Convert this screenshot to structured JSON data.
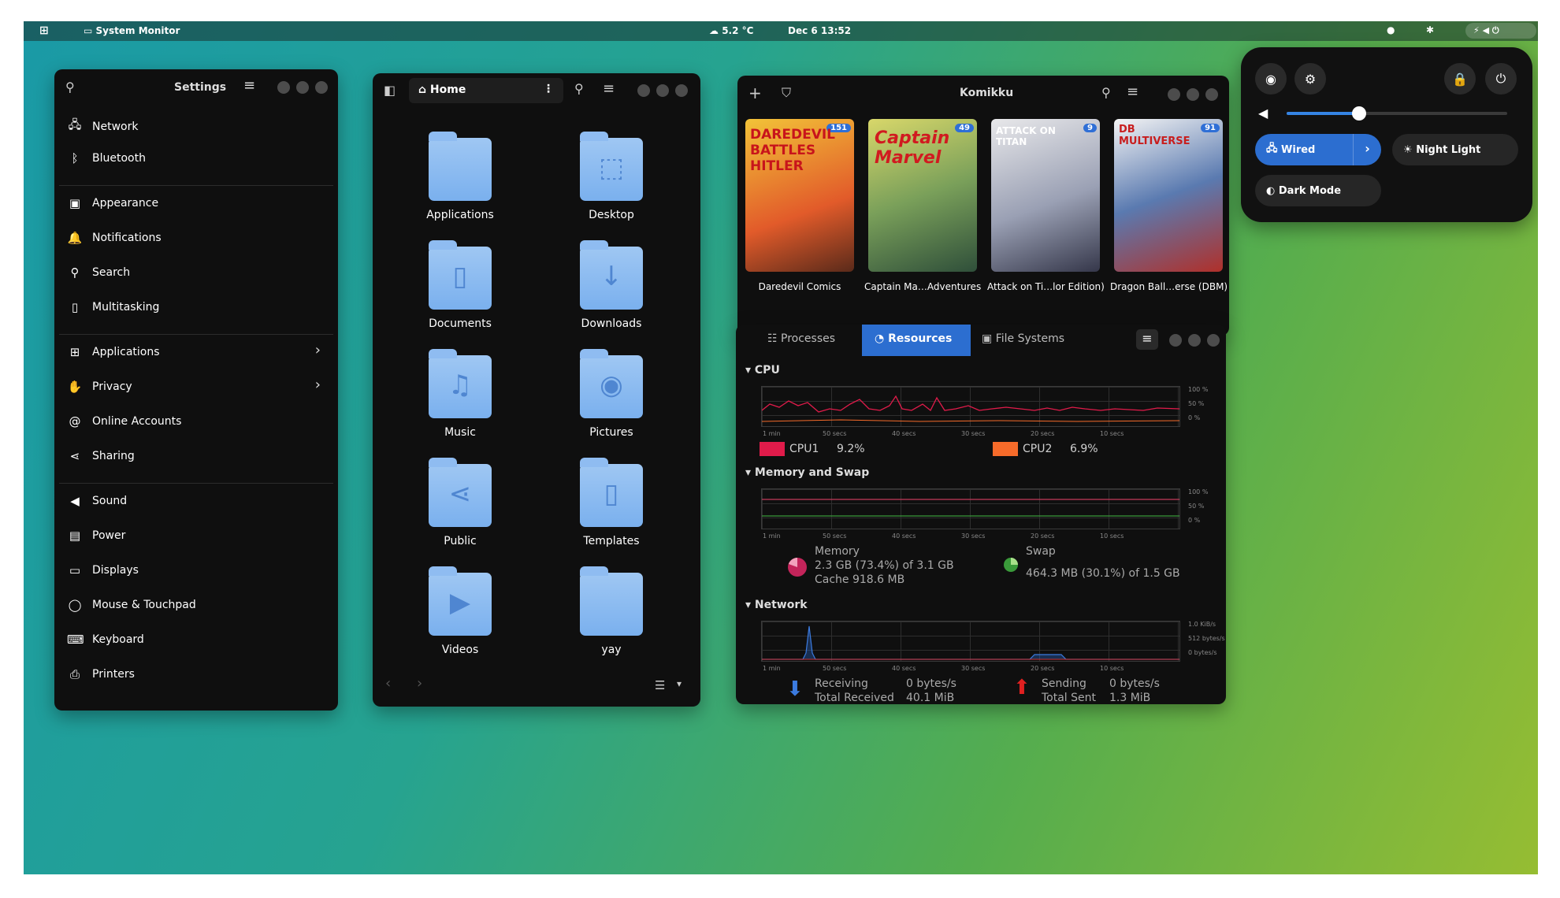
{
  "topbar": {
    "app": "System Monitor",
    "weather": "5.2 °C",
    "clock": "Dec 6  13:52"
  },
  "settings": {
    "title": "Settings",
    "items": [
      "Network",
      "Bluetooth",
      "Appearance",
      "Notifications",
      "Search",
      "Multitasking",
      "Applications",
      "Privacy",
      "Online Accounts",
      "Sharing",
      "Sound",
      "Power",
      "Displays",
      "Mouse & Touchpad",
      "Keyboard",
      "Printers"
    ]
  },
  "files": {
    "location": "Home",
    "folders": [
      "Applications",
      "Desktop",
      "Documents",
      "Downloads",
      "Music",
      "Pictures",
      "Public",
      "Templates",
      "Videos",
      "yay"
    ]
  },
  "komikku": {
    "title": "Komikku",
    "comics": [
      {
        "title": "Daredevil Comics",
        "badge": "151",
        "cover": "DAREDEVIL BATTLES HITLER"
      },
      {
        "title": "Captain Ma…Adventures",
        "badge": "49",
        "cover": "Captain Marvel"
      },
      {
        "title": "Attack on Ti…lor Edition)",
        "badge": "9",
        "cover": "ATTACK ON TITAN"
      },
      {
        "title": "Dragon Ball…erse (DBM)",
        "badge": "91",
        "cover": "DB MULTIVERSE"
      }
    ]
  },
  "monitor": {
    "tabs": [
      "Processes",
      "Resources",
      "File Systems"
    ],
    "cpu": {
      "label": "CPU",
      "cpu1": "CPU1",
      "cpu1_val": "9.2%",
      "cpu2": "CPU2",
      "cpu2_val": "6.9%",
      "cpu1_color": "#e01b4a",
      "cpu2_color": "#f66b2a"
    },
    "mem": {
      "label": "Memory and Swap",
      "memory": "Memory",
      "memory_val": "2.3 GB (73.4%) of 3.1 GB",
      "cache": "Cache 918.6 MB",
      "swap": "Swap",
      "swap_val": "464.3 MB (30.1%) of 1.5 GB"
    },
    "net": {
      "label": "Network",
      "receiving": "Receiving",
      "recv_val": "0 bytes/s",
      "total_recv": "Total Received",
      "total_recv_val": "40.1 MiB",
      "sending": "Sending",
      "send_val": "0 bytes/s",
      "total_sent": "Total Sent",
      "total_sent_val": "1.3 MiB"
    },
    "xticks": [
      "1 min",
      "50 secs",
      "40 secs",
      "30 secs",
      "20 secs",
      "10 secs"
    ],
    "yticks": [
      "100 %",
      "50 %",
      "0 %"
    ],
    "net_yticks": [
      "1.0 KiB/s",
      "512 bytes/s",
      "0 bytes/s"
    ]
  },
  "quick": {
    "wired": "Wired",
    "night": "Night Light",
    "dark": "Dark Mode",
    "volume": 0.33
  }
}
